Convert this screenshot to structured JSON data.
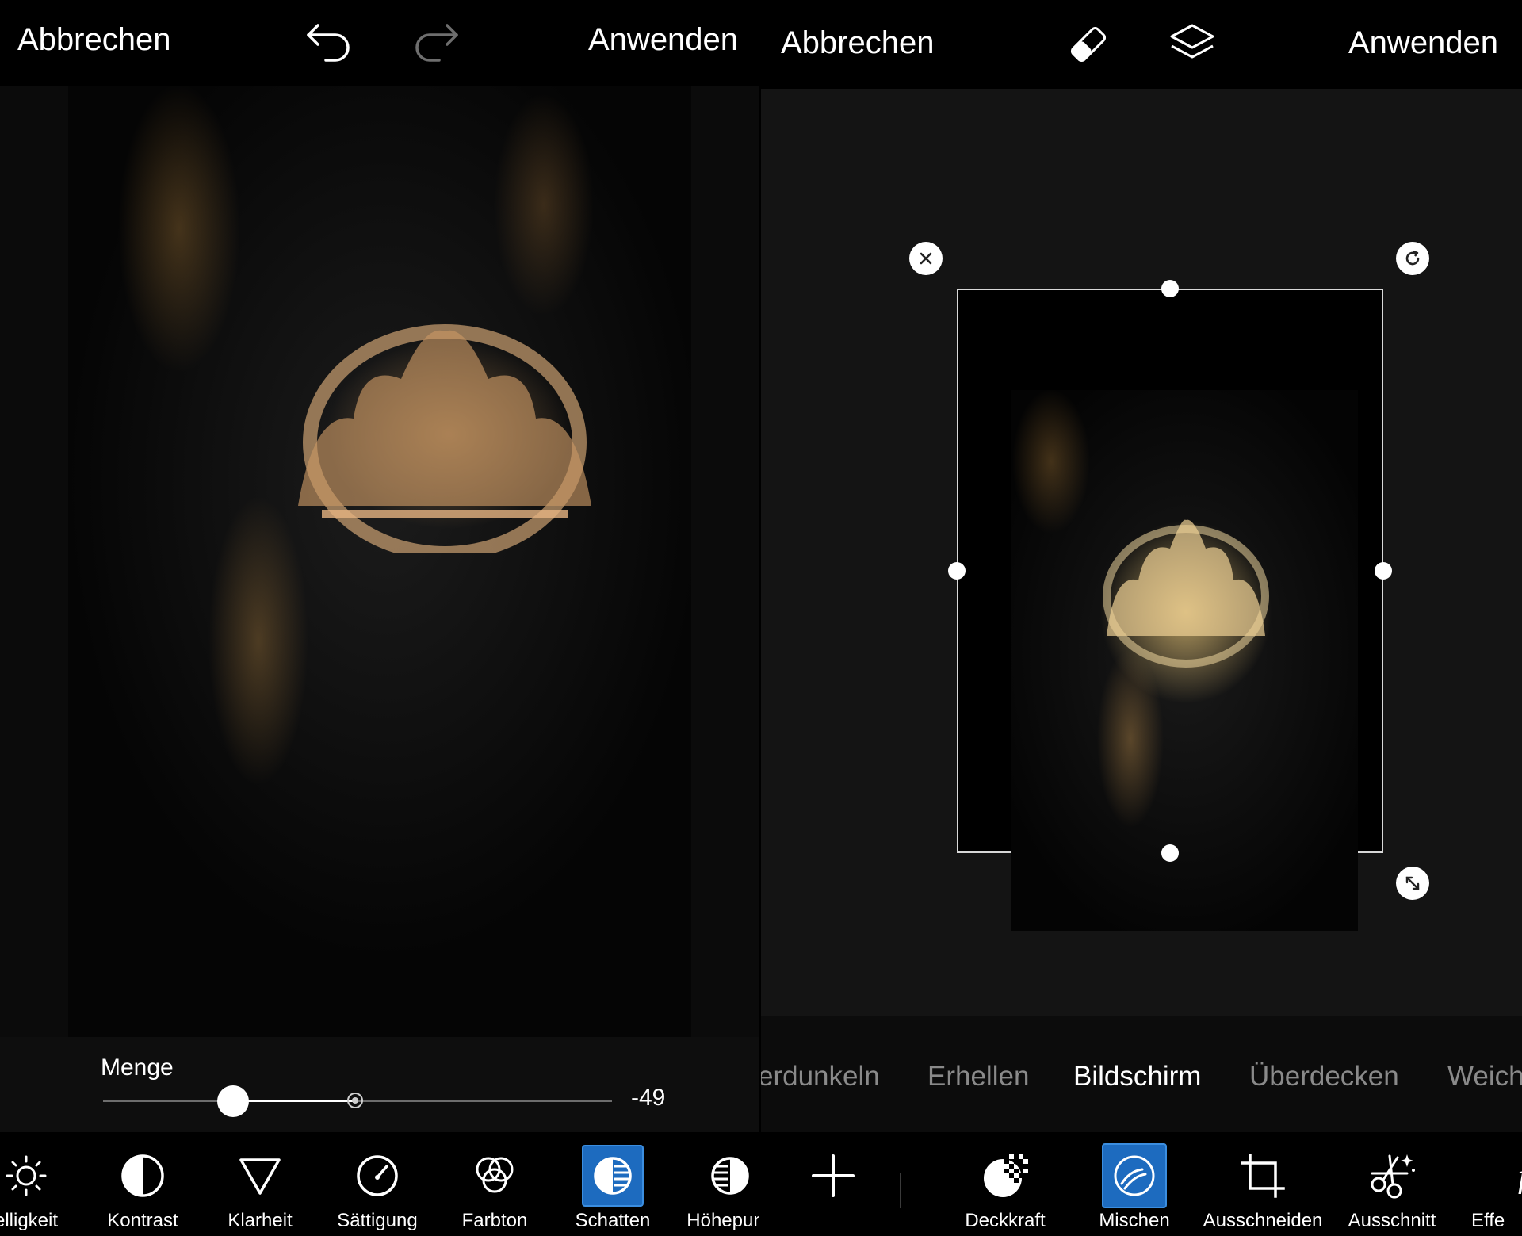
{
  "left_panel": {
    "topbar": {
      "cancel_label": "Abbrechen",
      "apply_label": "Anwenden",
      "undo_icon": "undo-icon",
      "redo_icon": "redo-icon"
    },
    "slider": {
      "label": "Menge",
      "value_text": "-49",
      "value": -49,
      "min": -100,
      "max": 100
    },
    "tools": [
      {
        "label": "elligkeit",
        "icon": "sun-icon",
        "active": false
      },
      {
        "label": "Kontrast",
        "icon": "contrast-icon",
        "active": false
      },
      {
        "label": "Klarheit",
        "icon": "triangle-icon",
        "active": false
      },
      {
        "label": "Sättigung",
        "icon": "gauge-icon",
        "active": false
      },
      {
        "label": "Farbton",
        "icon": "color-circles-icon",
        "active": false
      },
      {
        "label": "Schatten",
        "icon": "shadows-icon",
        "active": true
      },
      {
        "label": "Höhepunk",
        "icon": "highlights-icon",
        "active": false
      }
    ]
  },
  "right_panel": {
    "topbar": {
      "cancel_label": "Abbrechen",
      "apply_label": "Anwenden",
      "eraser_icon": "eraser-icon",
      "layers_icon": "layers-icon"
    },
    "blend_modes": [
      "erdunkeln",
      "Erhellen",
      "Bildschirm",
      "Überdecken",
      "Weich"
    ],
    "selected_blend_mode": "Bildschirm",
    "tools": [
      {
        "label": "Deckkraft",
        "icon": "opacity-icon",
        "active": false
      },
      {
        "label": "Mischen",
        "icon": "blend-icon",
        "active": true
      },
      {
        "label": "Ausschneiden",
        "icon": "crop-icon",
        "active": false
      },
      {
        "label": "Ausschnitt",
        "icon": "cutout-icon",
        "active": false
      },
      {
        "label": "Effe",
        "icon": "effects-icon",
        "active": false
      }
    ],
    "add_icon": "plus-icon"
  },
  "colors": {
    "accent": "#1d6bbf",
    "background": "#000000",
    "canvas": "#141414"
  }
}
